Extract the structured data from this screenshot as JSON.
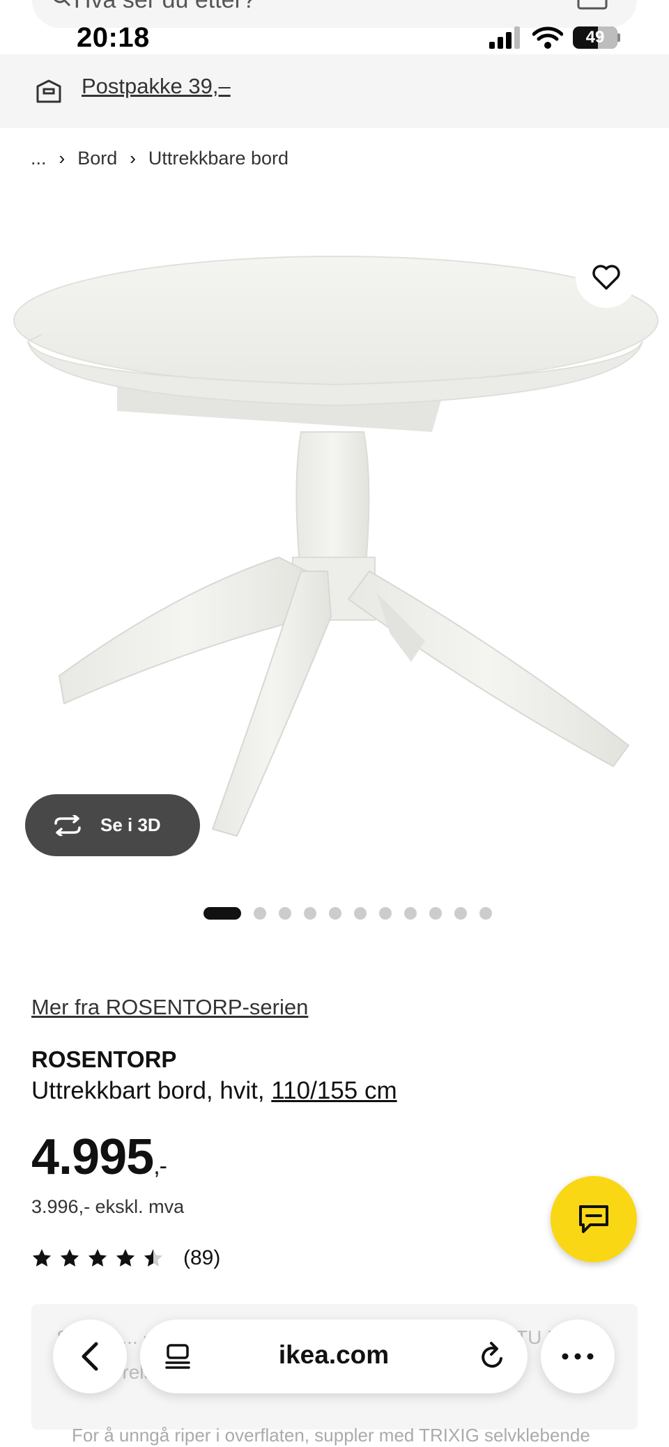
{
  "top_search": {
    "placeholder": "Hva ser du etter?"
  },
  "status_bar": {
    "time": "20:18",
    "battery": "49"
  },
  "delivery": {
    "label": "Postpakke 39,–"
  },
  "breadcrumb": {
    "items": [
      "...",
      "Bord",
      "Uttrekkbare bord"
    ]
  },
  "view_3d": {
    "label": "Se i 3D"
  },
  "carousel": {
    "total": 11,
    "active": 0
  },
  "product": {
    "series_link": "Mer fra ROSENTORP-serien",
    "name": "ROSENTORP",
    "description": "Uttrekkbart bord, hvit, ",
    "size": "110/155 cm",
    "price": "4.995",
    "price_suffix": ",-",
    "price_ex_vat": "3.996,- ekskl. mva",
    "rating": 4.5,
    "review_count": "(89)"
  },
  "info_box": {
    "line1": "Selges   ...   <2x 332 c 1 TTIUDTT 31 TTOTT, 9TT, TOTTU X 3,9>",
    "line2": "Vis størrelse 304,-, total 1 380,-"
  },
  "bottom_note": "For å unngå riper i overflaten, suppler med TRIXIG selvklebende",
  "browser": {
    "domain": "ikea.com"
  },
  "icons": {
    "delivery": "box-truck-icon",
    "favorite": "heart-icon",
    "view_3d": "rotate-3d-icon",
    "chat": "chat-bubble-icon",
    "back": "chevron-left-icon",
    "tabs": "tabs-icon",
    "reload": "reload-icon",
    "more": "more-horizontal-icon"
  },
  "colors": {
    "chat_button": "#fad714",
    "view_3d_button": "#484848",
    "banner": "#f5f5f5"
  }
}
